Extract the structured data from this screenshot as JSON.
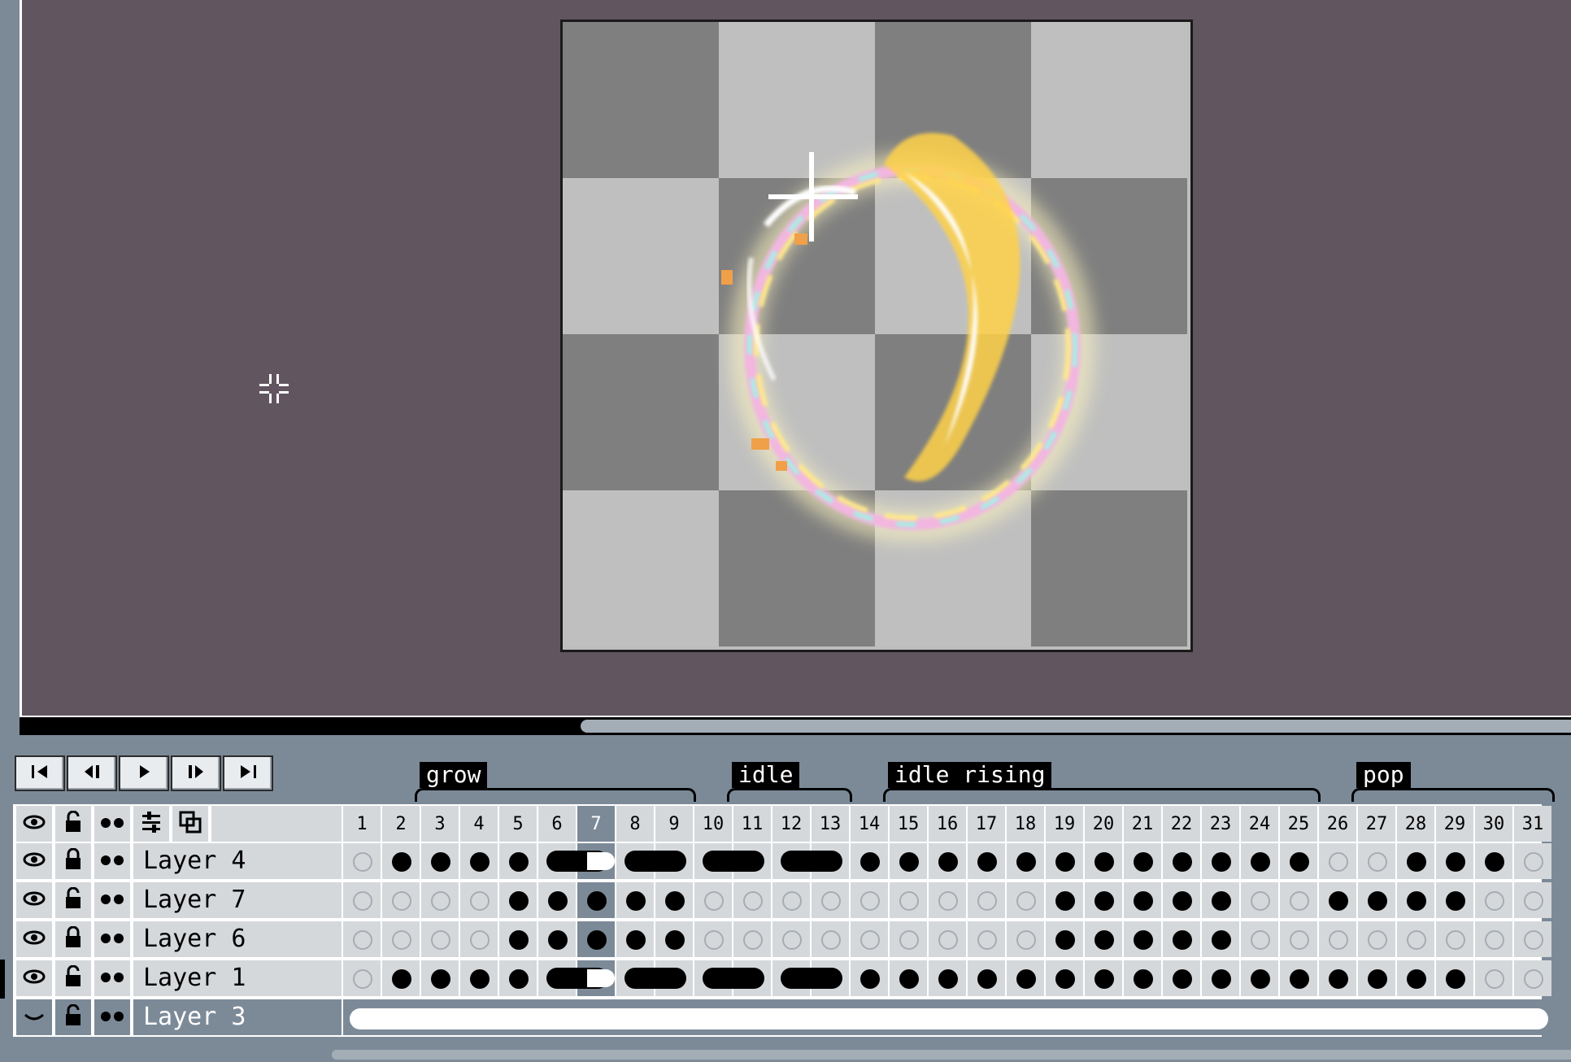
{
  "colors": {
    "canvas_bg": "#615560",
    "checker_light": "#bfbfbf",
    "checker_dark": "#7f7f7f",
    "panel": "#7c8a98",
    "cell": "#d5d8db",
    "selected_row": "#7c8a98"
  },
  "canvas": {
    "crosshair_icon": "resize-center-icon"
  },
  "playback": {
    "buttons": [
      {
        "name": "first-frame",
        "icon": "first-frame-icon"
      },
      {
        "name": "previous-frame",
        "icon": "previous-frame-icon"
      },
      {
        "name": "play",
        "icon": "play-icon"
      },
      {
        "name": "next-frame",
        "icon": "next-frame-icon"
      },
      {
        "name": "last-frame",
        "icon": "last-frame-icon"
      }
    ]
  },
  "tags": [
    {
      "label": "grow",
      "from": 2,
      "to": 9
    },
    {
      "label": "idle",
      "from": 10,
      "to": 13
    },
    {
      "label": "idle rising",
      "from": 14,
      "to": 25
    },
    {
      "label": "pop",
      "from": 26,
      "to": 31
    }
  ],
  "header_icons": [
    "eye-icon",
    "unlock-icon",
    "onion-skin-icon",
    "layer-settings-icon",
    "new-layer-icon"
  ],
  "frames": [
    "1",
    "2",
    "3",
    "4",
    "5",
    "6",
    "7",
    "8",
    "9",
    "10",
    "11",
    "12",
    "13",
    "14",
    "15",
    "16",
    "17",
    "18",
    "19",
    "20",
    "21",
    "22",
    "23",
    "24",
    "25",
    "26",
    "27",
    "28",
    "29",
    "30",
    "31"
  ],
  "current_frame": 7,
  "layers": [
    {
      "name": "Layer 4",
      "visible": true,
      "locked": true,
      "selected": false,
      "cels": "E,F,F,F,F,S6,S6,S8,S8,S10,S10,S12,S12,F,F,F,F,F,F,F,F,F,F,F,F,E,E,F,F,F,E"
    },
    {
      "name": "Layer 7",
      "visible": true,
      "locked": false,
      "selected": false,
      "cels": "E,E,E,E,F,F,F,F,F,E,E,E,E,E,E,E,E,E,F,F,F,F,F,E,E,F,F,F,F,E,E"
    },
    {
      "name": "Layer 6",
      "visible": true,
      "locked": true,
      "selected": false,
      "cels": "E,E,E,E,F,F,F,F,F,E,E,E,E,E,E,E,E,E,F,F,F,F,F,E,E,E,E,E,E,E,E"
    },
    {
      "name": "Layer 1",
      "visible": true,
      "locked": false,
      "selected": false,
      "cels": "E,F,F,F,F,S6,S6,S8,S8,S10,S10,S12,S12,F,F,F,F,F,F,F,F,F,F,F,F,F,F,F,F,E,E"
    },
    {
      "name": "Layer 3",
      "visible": false,
      "locked": false,
      "selected": true,
      "cels": "W"
    }
  ]
}
